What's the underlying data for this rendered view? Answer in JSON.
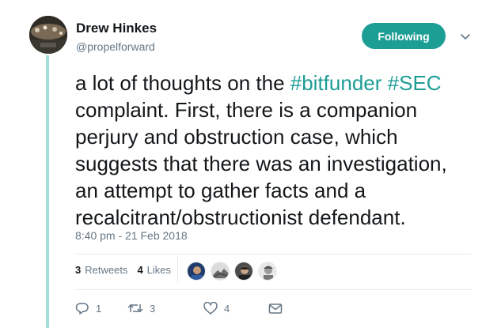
{
  "author": {
    "name": "Drew Hinkes",
    "handle": "@propelforward"
  },
  "follow_button": {
    "label": "Following"
  },
  "tweet": {
    "line1_prefix": "a lot of thoughts on the ",
    "hashtag1": "#bitfunder",
    "hashtag2": "#SEC",
    "line2": "complaint. First, there is a companion",
    "line3": "perjury and obstruction case, which",
    "line4": "suggests that there was an investigation,",
    "line5": "an attempt to gather facts and a",
    "line6": "recalcitrant/obstructionist defendant."
  },
  "timestamp": "8:40 pm - 21 Feb 2018",
  "stats": {
    "retweets_count": "3",
    "retweets_label": "Retweets",
    "likes_count": "4",
    "likes_label": "Likes"
  },
  "likers": [
    "liker-avatar",
    "liker-avatar",
    "liker-avatar",
    "liker-avatar"
  ],
  "actions": {
    "reply_count": "1",
    "retweet_count": "3",
    "like_count": "4"
  },
  "icons": {
    "caret": "chevron-down-icon",
    "reply": "reply-icon",
    "retweet": "retweet-icon",
    "like": "heart-icon",
    "dm": "envelope-icon"
  },
  "colors": {
    "accent": "#1d9e95",
    "thread_line": "#9fe0d9",
    "muted": "#657786"
  }
}
